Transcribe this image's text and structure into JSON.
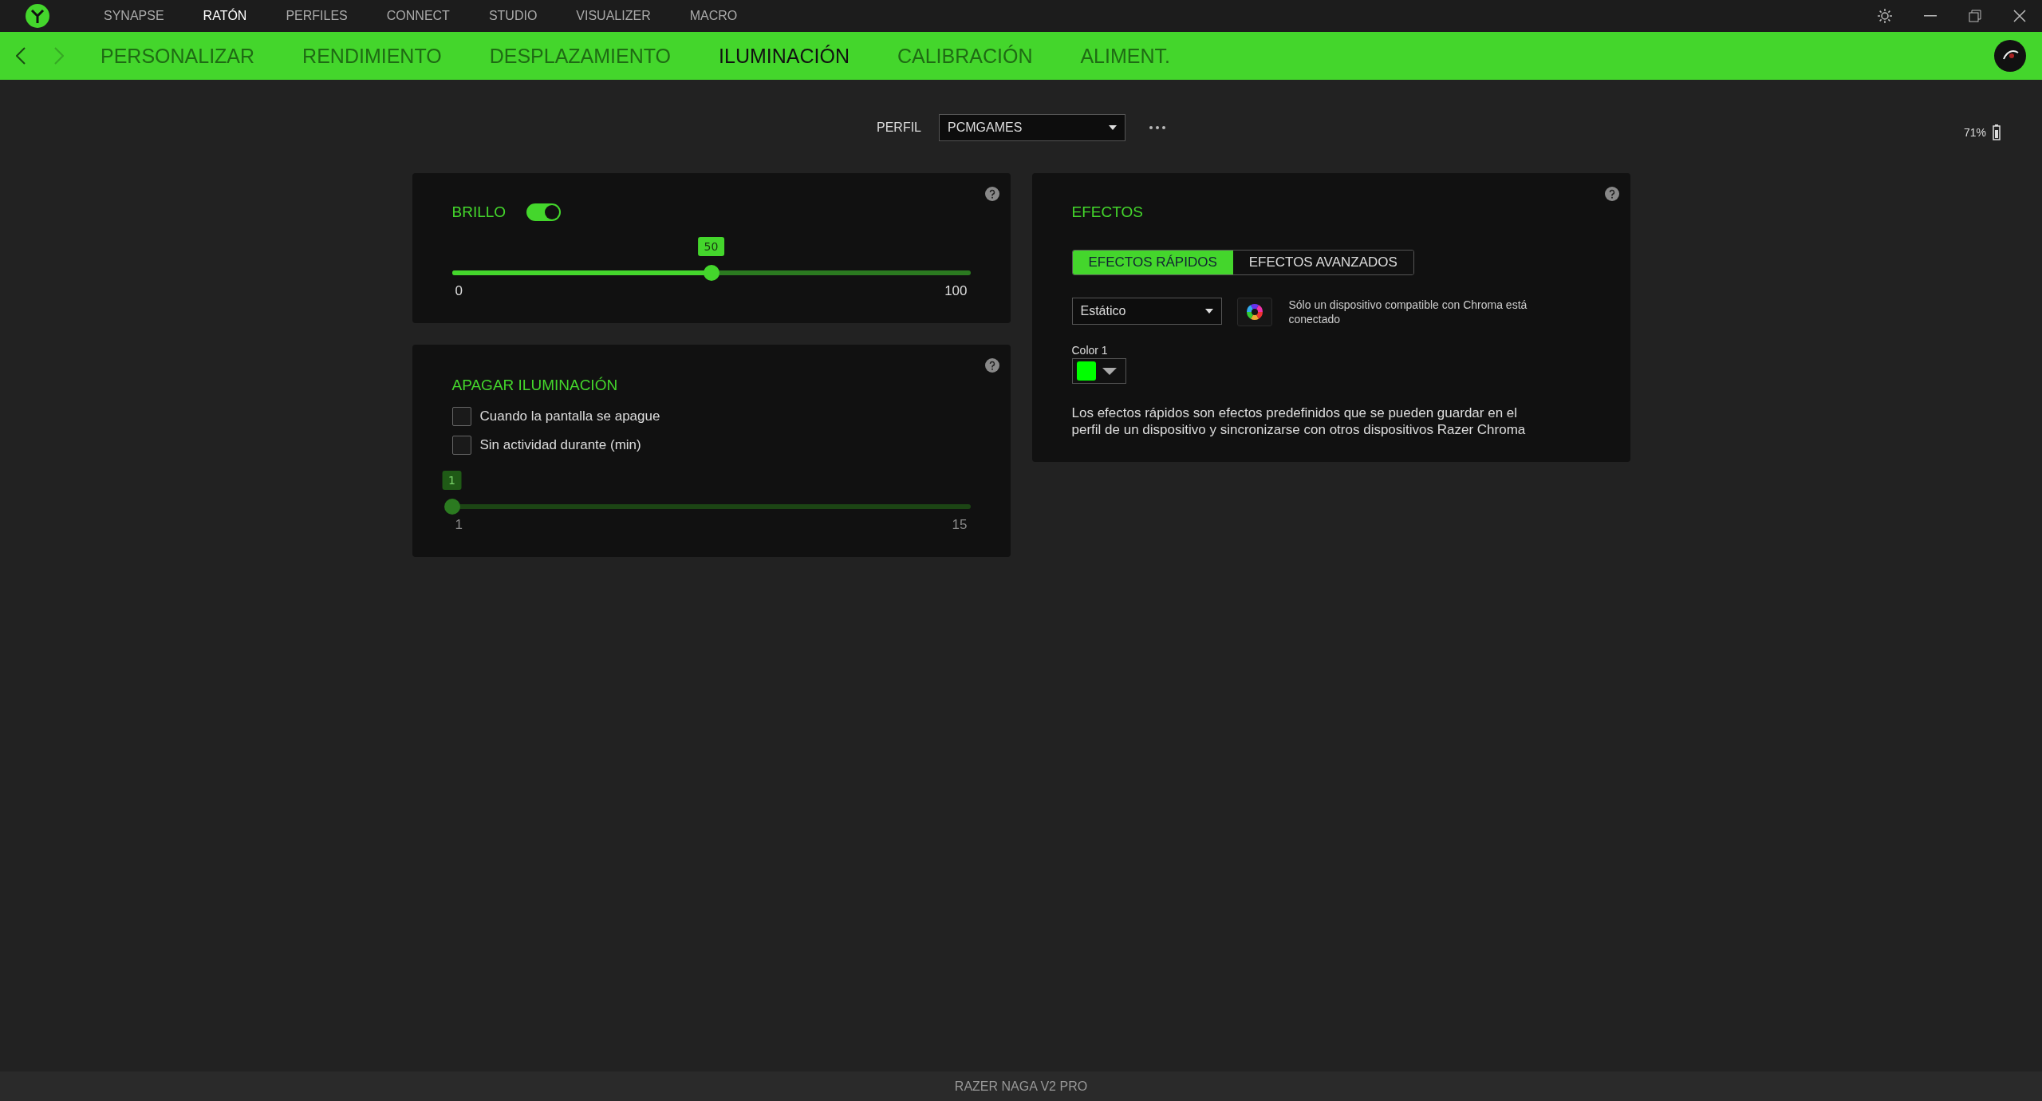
{
  "top_menu": [
    {
      "label": "SYNAPSE",
      "selected": false
    },
    {
      "label": "RATÓN",
      "selected": true
    },
    {
      "label": "PERFILES",
      "selected": false
    },
    {
      "label": "CONNECT",
      "selected": false
    },
    {
      "label": "STUDIO",
      "selected": false
    },
    {
      "label": "VISUALIZER",
      "selected": false
    },
    {
      "label": "MACRO",
      "selected": false
    }
  ],
  "sub_tabs": [
    {
      "label": "PERSONALIZAR",
      "selected": false
    },
    {
      "label": "RENDIMIENTO",
      "selected": false
    },
    {
      "label": "DESPLAZAMIENTO",
      "selected": false
    },
    {
      "label": "ILUMINACIÓN",
      "selected": true
    },
    {
      "label": "CALIBRACIÓN",
      "selected": false
    },
    {
      "label": "ALIMENT.",
      "selected": false
    }
  ],
  "profile": {
    "label": "PERFIL",
    "value": "PCMGAMES"
  },
  "battery": {
    "reading": "71%"
  },
  "brightness": {
    "title": "BRILLO",
    "on": true,
    "value": "50",
    "level": 0.5,
    "min": "0",
    "max": "100"
  },
  "lighting_off": {
    "title": "APAGAR ILUMINACIÓN",
    "options": [
      {
        "label": "Cuando la pantalla se apague",
        "checked": false
      },
      {
        "label": "Sin actividad durante (min)",
        "checked": false
      }
    ],
    "slider": {
      "value": "1",
      "level": 0,
      "min": "1",
      "max": "15",
      "disabled": true
    }
  },
  "effects": {
    "title": "EFECTOS",
    "tabs": [
      {
        "label": "EFECTOS RÁPIDOS",
        "selected": true
      },
      {
        "label": "EFECTOS AVANZADOS",
        "selected": false
      }
    ],
    "effect": "Estático",
    "chroma_note": "Sólo un dispositivo compatible con Chroma está conectado",
    "color_label": "Color 1",
    "color": "#00ff00",
    "description": "Los efectos rápidos son efectos predefinidos que se pueden guardar en el perfil de un dispositivo y sincronizarse con otros dispositivos Razer Chroma"
  },
  "status_bar": {
    "device": "RAZER NAGA V2 PRO"
  }
}
